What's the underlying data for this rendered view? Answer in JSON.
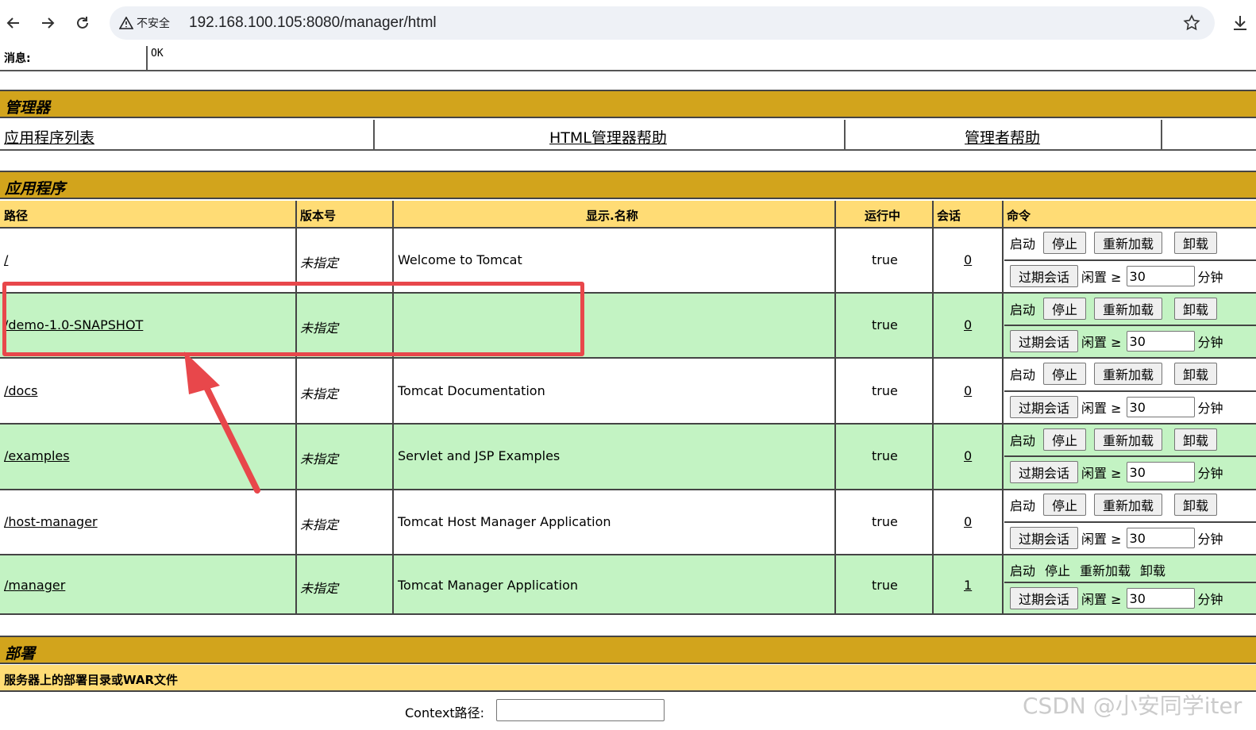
{
  "browser": {
    "security_label": "不安全",
    "url": "192.168.100.105:8080/manager/html"
  },
  "message": {
    "label": "消息:",
    "value": "OK"
  },
  "manager": {
    "title": "管理器",
    "links": [
      "应用程序列表",
      "HTML管理器帮助",
      "管理者帮助"
    ]
  },
  "applications": {
    "title": "应用程序",
    "headers": {
      "path": "路径",
      "version": "版本号",
      "display": "显示.名称",
      "running": "运行中",
      "sessions": "会话",
      "commands": "命令"
    },
    "rows": [
      {
        "path": "/",
        "version": "未指定",
        "display": "Welcome to Tomcat",
        "running": "true",
        "sessions": "0"
      },
      {
        "path": "/demo-1.0-SNAPSHOT",
        "version": "未指定",
        "display": "",
        "running": "true",
        "sessions": "0"
      },
      {
        "path": "/docs",
        "version": "未指定",
        "display": "Tomcat Documentation",
        "running": "true",
        "sessions": "0"
      },
      {
        "path": "/examples",
        "version": "未指定",
        "display": "Servlet and JSP Examples",
        "running": "true",
        "sessions": "0"
      },
      {
        "path": "/host-manager",
        "version": "未指定",
        "display": "Tomcat Host Manager Application",
        "running": "true",
        "sessions": "0"
      },
      {
        "path": "/manager",
        "version": "未指定",
        "display": "Tomcat Manager Application",
        "running": "true",
        "sessions": "1"
      }
    ],
    "commands": {
      "start": "启动",
      "stop": "停止",
      "reload": "重新加载",
      "undeploy": "卸载",
      "expire": "过期会话",
      "idle": "闲置 ≥",
      "idle_value": "30",
      "minutes": "分钟"
    }
  },
  "deploy": {
    "title": "部署",
    "subtitle": "服务器上的部署目录或WAR文件",
    "context_label": "Context路径:"
  },
  "watermark": "CSDN @小安同学iter"
}
